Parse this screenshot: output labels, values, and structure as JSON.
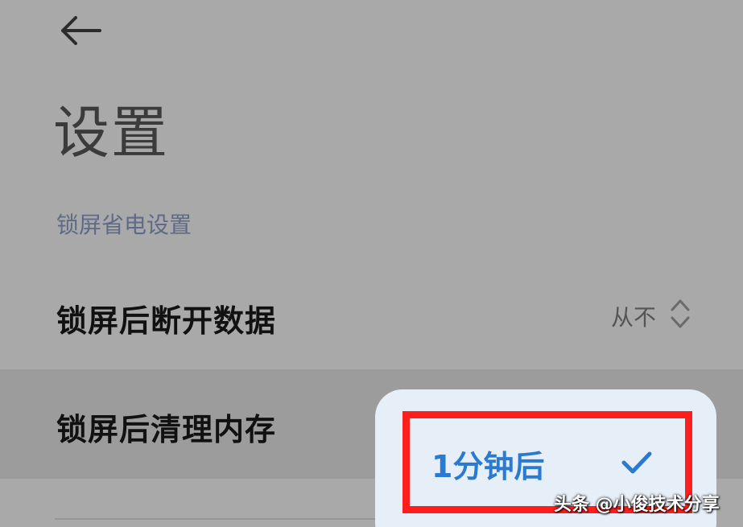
{
  "header": {
    "back_icon": "arrow-left-icon",
    "title": "设置"
  },
  "section": {
    "title": "锁屏省电设置"
  },
  "rows": [
    {
      "label": "锁屏后断开数据",
      "value": "从不",
      "icon": "chevron-up-down-icon"
    },
    {
      "label": "锁屏后清理内存"
    }
  ],
  "popup": {
    "options": [
      {
        "label": "1分钟后",
        "selected": true,
        "icon": "checkmark-icon"
      }
    ]
  },
  "watermark": "头条 @小俊技术分享",
  "colors": {
    "background": "#a9a9a9",
    "accent": "#2a7ad0",
    "highlight": "#ff1e1e",
    "popup_bg": "#e6eef8"
  }
}
